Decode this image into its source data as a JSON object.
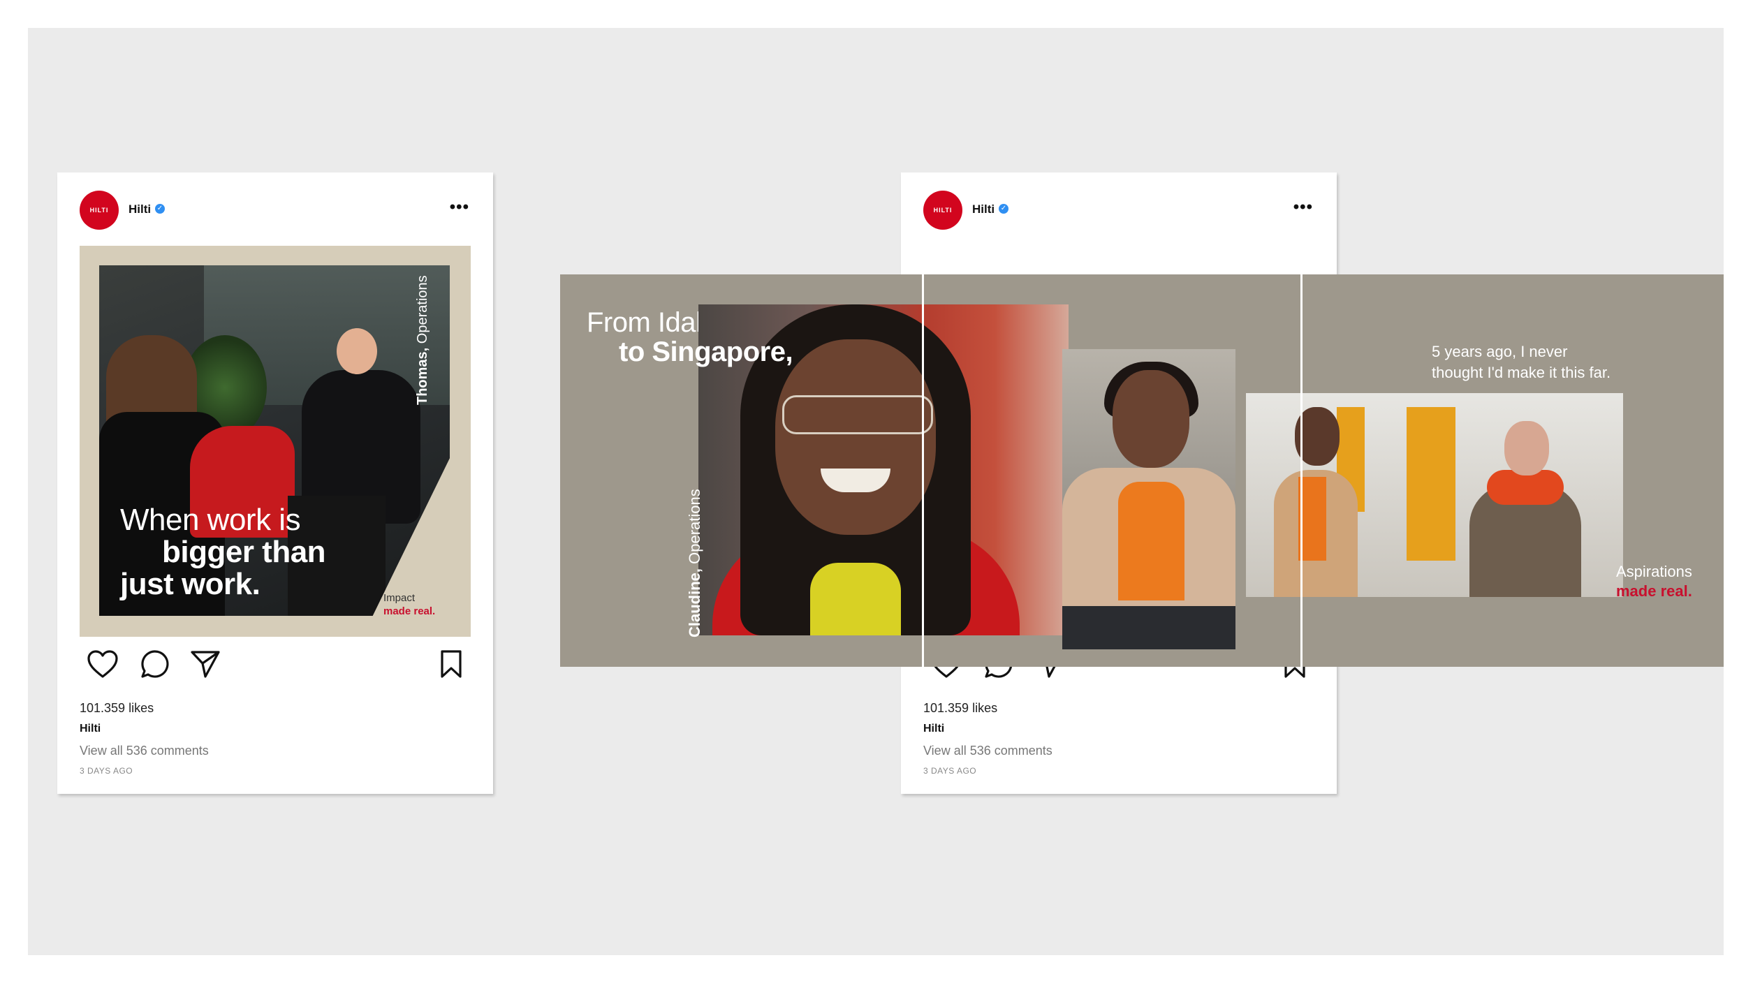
{
  "post_left": {
    "username": "Hilti",
    "logo_text": "HILTI",
    "media": {
      "vertical_name": "Thomas,",
      "vertical_role": " Operations",
      "headline_line1": "When work is",
      "headline_line2": "bigger than",
      "headline_line3": "just work.",
      "tag_line1": "Impact",
      "tag_line2": "made real."
    },
    "likes": "101.359 likes",
    "caption_user": "Hilti",
    "comments": "View all 536 comments",
    "time_ago": "3 DAYS AGO"
  },
  "post_right": {
    "username": "Hilti",
    "logo_text": "HILTI",
    "likes": "101.359 likes",
    "caption_user": "Hilti",
    "comments": "View all 536 comments",
    "time_ago": "3 DAYS AGO"
  },
  "banner": {
    "headline_line1": "From Idaho",
    "headline_line2": "to Singapore,",
    "vertical_name": "Claudine,",
    "vertical_role": " Operations",
    "quote_line1": "5 years ago, I never",
    "quote_line2": "thought I'd make it this far.",
    "tag_line1": "Aspirations",
    "tag_line2": "made real."
  },
  "colors": {
    "brand_red": "#d2051e",
    "banner_bg": "#9e988c",
    "art_beige": "#d6cdb9",
    "stage_bg": "#ebebeb"
  },
  "icons": [
    "heart-icon",
    "comment-icon",
    "send-icon",
    "bookmark-icon",
    "more-icon",
    "verified-icon"
  ]
}
